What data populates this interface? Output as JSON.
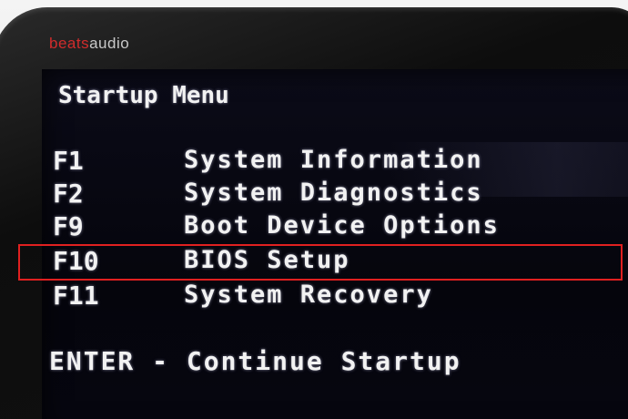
{
  "bezel": {
    "brand_primary": "beats",
    "brand_secondary": "audio",
    "brand_color": "#d12c2c"
  },
  "startup_menu": {
    "title": "Startup Menu",
    "items": [
      {
        "key": "F1",
        "label": "System Information"
      },
      {
        "key": "F2",
        "label": "System Diagnostics"
      },
      {
        "key": "F9",
        "label": "Boot Device Options"
      },
      {
        "key": "F10",
        "label": "BIOS Setup",
        "highlighted": true
      },
      {
        "key": "F11",
        "label": "System Recovery"
      }
    ],
    "enter_line": "ENTER - Continue Startup",
    "highlight_color": "#e02020"
  }
}
